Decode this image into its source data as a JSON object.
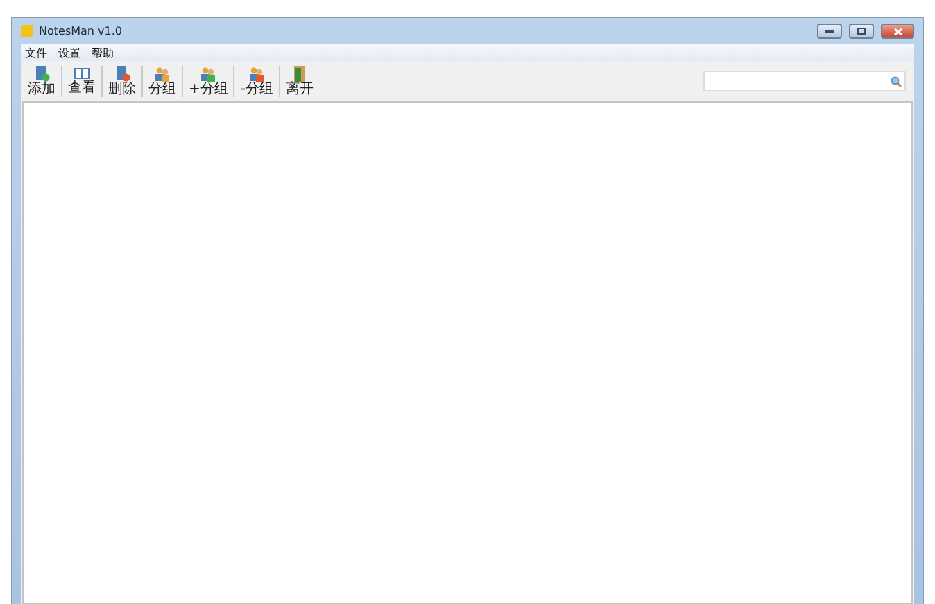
{
  "window": {
    "title": "NotesMan v1.0"
  },
  "menu": [
    "文件",
    "设置",
    "帮助"
  ],
  "toolbar": [
    {
      "label": "添加",
      "kind": "add"
    },
    {
      "label": "查看",
      "kind": "view"
    },
    {
      "label": "删除",
      "kind": "delete"
    },
    {
      "label": "分组",
      "kind": "group"
    },
    {
      "label": "+分组",
      "kind": "group-add"
    },
    {
      "label": "-分组",
      "kind": "group-remove"
    },
    {
      "label": "离开",
      "kind": "exit"
    }
  ]
}
